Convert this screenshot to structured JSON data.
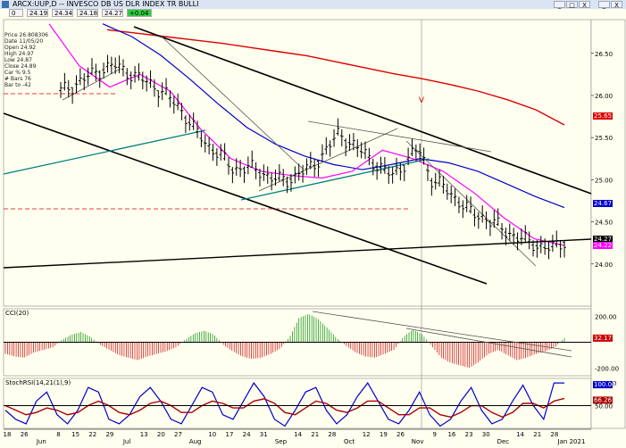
{
  "window": {
    "title": "ARCX:UUP,D -- INVESCO DB US DLR INDEX TR BULLI",
    "buttons": [
      "_",
      "□",
      "X"
    ]
  },
  "toolbar": {
    "boxes": [
      "0",
      "24.19",
      "24.34",
      "24.18",
      "24.27",
      "+0.04"
    ]
  },
  "info_panel": [
    "Price  26.808306",
    "Date   11/05/20",
    "Open  24.92",
    "High  24.97",
    "Low   24.87",
    "Close  24.89",
    "Car %  9.5",
    "# Bars 76",
    "Bar to -42"
  ],
  "markers": {
    "v_label": "V"
  },
  "colors": {
    "price_bar": "#000000",
    "ma_red": "#dd0000",
    "ma_blue": "#0000cc",
    "ma_magenta": "#ff00ff",
    "trend_black": "#000000",
    "trend_teal": "#008080",
    "cci_up": "#008800",
    "cci_down": "#cc0000",
    "rsi_blue": "#0000cc",
    "rsi_red": "#aa0000"
  },
  "chart_data": [
    {
      "type": "ohlc",
      "series": [
        {
          "name": "UUP",
          "values": [
            26.05,
            26.12,
            26.22,
            26.3,
            26.36,
            26.28,
            26.2,
            26.12,
            26.0,
            25.85,
            25.62,
            25.42,
            25.3,
            25.12,
            25.15,
            25.1,
            25.02,
            24.98,
            25.08,
            25.15,
            25.35,
            25.55,
            25.42,
            25.3,
            25.15,
            25.05,
            25.2,
            25.38,
            25.0,
            24.9,
            24.75,
            24.6,
            24.55,
            24.45,
            24.35,
            24.28,
            24.22,
            24.18,
            24.27
          ]
        },
        {
          "name": "MA long (red)",
          "values": [
            26.78,
            26.74,
            26.7,
            26.66,
            26.62,
            26.57,
            26.52,
            26.47,
            26.4,
            26.33,
            26.26,
            26.2,
            26.13,
            26.05,
            25.95,
            25.83,
            25.65
          ]
        },
        {
          "name": "MA mid (blue)",
          "values": [
            26.85,
            26.7,
            26.48,
            26.2,
            25.9,
            25.62,
            25.42,
            25.28,
            25.18,
            25.12,
            25.18,
            25.25,
            25.2,
            25.1,
            24.95,
            24.8,
            24.67
          ]
        },
        {
          "name": "MA short (magenta)",
          "values": [
            26.85,
            26.35,
            26.1,
            26.25,
            26.05,
            25.6,
            25.25,
            25.1,
            25.05,
            25.02,
            25.1,
            25.35,
            25.25,
            25.1,
            24.85,
            24.55,
            24.3,
            24.22
          ]
        }
      ],
      "x_tick_labels": [
        "18",
        "26",
        "Jun",
        "8",
        "15",
        "22",
        "29",
        "Jul",
        "13",
        "20",
        "27",
        "Aug",
        "10",
        "17",
        "24",
        "31",
        "Sep",
        "14",
        "21",
        "28",
        "Oct",
        "12",
        "19",
        "26",
        "Nov",
        "9",
        "16",
        "23",
        "30",
        "Dec",
        "14",
        "21",
        "28",
        "Jan 2021"
      ],
      "y_ticks": [
        "26.50",
        "26.00",
        "25.50",
        "25.00",
        "24.50",
        "24.00"
      ],
      "ylim": [
        23.5,
        26.9
      ],
      "last_value_labels": [
        {
          "text": "25.65",
          "color": "#dd0000"
        },
        {
          "text": "24.67",
          "color": "#0000cc"
        },
        {
          "text": "24.27",
          "color": "#000000"
        },
        {
          "text": "24.22",
          "color": "#ff00ff"
        }
      ]
    },
    {
      "type": "bar",
      "title": "CCI(20)",
      "values": [
        -90,
        -110,
        -120,
        -80,
        -60,
        -40,
        20,
        60,
        80,
        40,
        -20,
        -60,
        -100,
        -120,
        -140,
        -110,
        -90,
        -70,
        -40,
        20,
        70,
        90,
        60,
        -20,
        -70,
        -110,
        -130,
        -120,
        -90,
        -50,
        40,
        190,
        220,
        180,
        110,
        30,
        -30,
        -80,
        -110,
        -120,
        -90,
        -60,
        40,
        100,
        60,
        -30,
        -120,
        -160,
        -180,
        -200,
        -150,
        -90,
        -60,
        -100,
        -140,
        -120,
        -90,
        -70,
        -40,
        32
      ],
      "y_ticks": [
        "200.00",
        "-200.00"
      ],
      "ylim": [
        -260,
        260
      ],
      "last_value": "32.17"
    },
    {
      "type": "line",
      "title": "StochRSI(14,21(1),9)",
      "series": [
        {
          "name": "StochRSI",
          "values": [
            40,
            20,
            10,
            60,
            80,
            30,
            10,
            40,
            90,
            80,
            20,
            10,
            30,
            70,
            90,
            60,
            20,
            10,
            50,
            90,
            80,
            30,
            20,
            60,
            100,
            70,
            20,
            5,
            40,
            80,
            90,
            40,
            10,
            30,
            70,
            100,
            60,
            20,
            10,
            40,
            80,
            30,
            5,
            20,
            60,
            90,
            40,
            10,
            20,
            60,
            95,
            50,
            20,
            100,
            100
          ]
        },
        {
          "name": "signal",
          "values": [
            50,
            40,
            30,
            35,
            45,
            40,
            30,
            35,
            50,
            60,
            50,
            35,
            30,
            40,
            55,
            60,
            50,
            35,
            35,
            50,
            60,
            55,
            45,
            45,
            60,
            65,
            55,
            35,
            30,
            45,
            60,
            55,
            40,
            35,
            45,
            60,
            60,
            45,
            30,
            30,
            45,
            45,
            30,
            25,
            35,
            50,
            50,
            35,
            25,
            35,
            55,
            55,
            45,
            60,
            66
          ]
        }
      ],
      "y_ticks": [
        "100.00",
        "50.00"
      ],
      "ylim": [
        0,
        110
      ],
      "last_values": [
        "100.00",
        "66.26"
      ]
    }
  ]
}
